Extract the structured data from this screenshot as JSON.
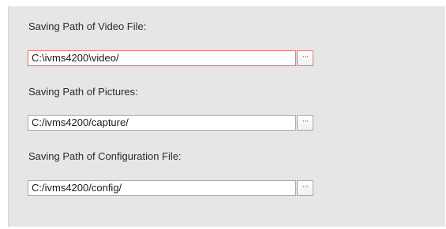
{
  "paths": [
    {
      "label": "Saving Path of Video File:",
      "value": "C:\\ivms4200\\video/",
      "browse_label": "···"
    },
    {
      "label": "Saving Path of Pictures:",
      "value": "C:/ivms4200/capture/",
      "browse_label": "···"
    },
    {
      "label": "Saving Path of Configuration File:",
      "value": "C:/ivms4200/config/",
      "browse_label": "···"
    }
  ],
  "colors": {
    "panel_background": "#e6e6e6",
    "focused_border": "#e07a7a",
    "field_border": "#a9a9a9"
  }
}
